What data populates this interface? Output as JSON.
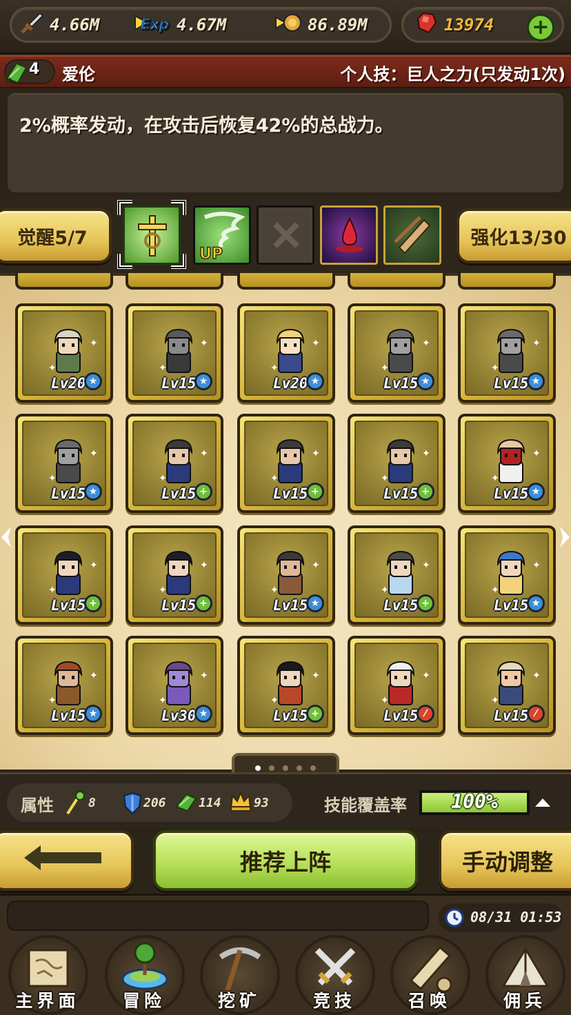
{
  "resources": {
    "attack": "4.66M",
    "exp": "4.67M",
    "gold": "86.89M",
    "gems": "13974"
  },
  "hero": {
    "level": "4",
    "name": "爱伦",
    "skill": "个人技：巨人之力(只发动1次)",
    "description": "2%概率发动，在攻击后恢复42%的总战力。"
  },
  "buttons": {
    "awaken": "觉醒5/7",
    "enhance": "强化13/30",
    "recommend": "推荐上阵",
    "manual": "手动调整"
  },
  "roster": [
    {
      "level": "Lv20",
      "badge": "star",
      "sprite": "old-sage"
    },
    {
      "level": "Lv15",
      "badge": "star",
      "sprite": "dark-knight"
    },
    {
      "level": "Lv20",
      "badge": "star",
      "sprite": "blonde-knight"
    },
    {
      "level": "Lv15",
      "badge": "star",
      "sprite": "armor-knight"
    },
    {
      "level": "Lv15",
      "badge": "star",
      "sprite": "armor-knight"
    },
    {
      "level": "Lv15",
      "badge": "star",
      "sprite": "armor-knight"
    },
    {
      "level": "Lv15",
      "badge": "plus",
      "sprite": "cloaked-scout"
    },
    {
      "level": "Lv15",
      "badge": "plus",
      "sprite": "cloaked-scout"
    },
    {
      "level": "Lv15",
      "badge": "plus",
      "sprite": "cloaked-scout"
    },
    {
      "level": "Lv15",
      "badge": "star",
      "sprite": "bald-officer"
    },
    {
      "level": "Lv15",
      "badge": "plus",
      "sprite": "dark-ninja"
    },
    {
      "level": "Lv15",
      "badge": "plus",
      "sprite": "dark-ninja"
    },
    {
      "level": "Lv15",
      "badge": "star",
      "sprite": "bearded-brawler"
    },
    {
      "level": "Lv15",
      "badge": "plus",
      "sprite": "maid"
    },
    {
      "level": "Lv15",
      "badge": "star",
      "sprite": "blue-mage"
    },
    {
      "level": "Lv15",
      "badge": "star",
      "sprite": "barbarian-chief"
    },
    {
      "level": "Lv30",
      "badge": "star",
      "sprite": "purple-elf"
    },
    {
      "level": "Lv15",
      "badge": "plus",
      "sprite": "black-hair-girl"
    },
    {
      "level": "Lv15",
      "badge": "red",
      "sprite": "white-hair-hero"
    },
    {
      "level": "Lv15",
      "badge": "red",
      "sprite": "dwarf"
    }
  ],
  "stats": {
    "attr_label": "属性",
    "sword": "8",
    "shield": "206",
    "gem": "114",
    "crown": "93",
    "coverage_label": "技能覆盖率",
    "coverage_value": "100%",
    "coverage_fraction": 1.0
  },
  "pages": {
    "count": 5,
    "active": 0
  },
  "clock": "08/31 01:53",
  "nav": [
    {
      "label": "主界面",
      "icon": "map-scroll-icon"
    },
    {
      "label": "冒险",
      "icon": "island-icon"
    },
    {
      "label": "挖矿",
      "icon": "pickaxe-icon"
    },
    {
      "label": "竞技",
      "icon": "crossed-swords-icon"
    },
    {
      "label": "召唤",
      "icon": "scroll-icon"
    },
    {
      "label": "佣兵",
      "icon": "tent-icon"
    }
  ],
  "colors": {
    "gold_card": "#d4b238",
    "green_button": "#b7e05a",
    "yellow_button": "#e6c559",
    "header_red": "#7b2b1c",
    "badge_star": "#3d8ed8",
    "badge_plus": "#6fbf3b",
    "badge_red": "#d9462a"
  }
}
